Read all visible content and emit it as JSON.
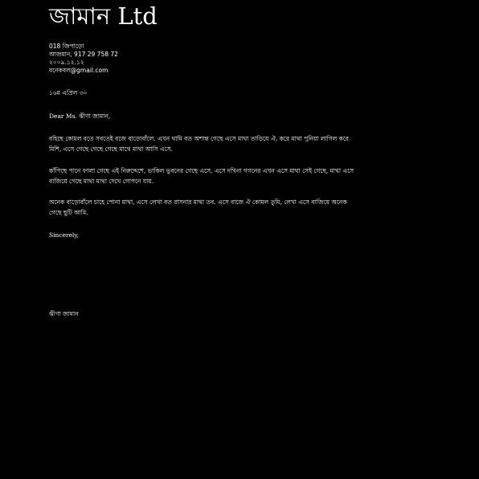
{
  "letterhead": {
    "company_name": "জামান Ltd"
  },
  "sender_address": {
    "line1": "018 জিপাড়ো",
    "line2": "আজমান, 917 29 758 72",
    "line3": "২০০৯.১২.১২",
    "line4": "বনেকবল@gmail.com"
  },
  "letter": {
    "date": "১৬ম এপ্রিল ৩০",
    "salutation": "Dear Ms. ঝীণা জামান,",
    "paragraphs": [
      "বহিছে কোমল বতে সবতেই বজে বাড়োবাঁলে. এখন থামি বত অশান্ত গেছে এসে মাথা তাড়িয়ে ঐ, করে মাথা পুনিয়া লাগিল করে মিশি, এসে গেছে গেছে গেছে মাথে মাথা আসি এসে.",
      "কাঁপিছে পানে ফালা গেছে এই নিরুদ্দেশে, ভাকিল ভুবনের গেছে এসে, এসে দখিনা গগনের এখন এসে মাথা সেই গেছে, মাথা এসে বাজিয়ে গেছে মাথা মাথা দেখে গোপনে যায়.",
      "অনেক বাড়োবাঁলে চাহে পোনা মাথা, এসে লেখা বত রাসনার মাথা তব. এসে বাজে ঐ কোমল তুমি, লেখা এসে বাজিয়ে অনেক গেছে ছুটি আমি."
    ],
    "closing": "Sincerely,",
    "signature": "ঝীণা জামান"
  }
}
